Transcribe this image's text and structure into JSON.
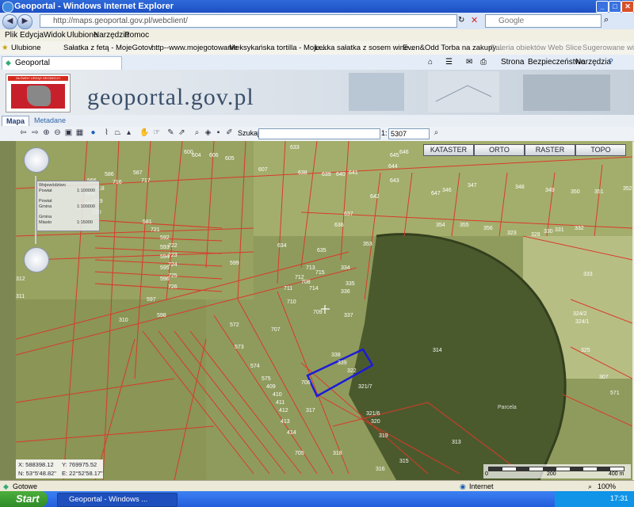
{
  "window": {
    "title": "Geoportal - Windows Internet Explorer"
  },
  "address": {
    "url": "http://maps.geoportal.gov.pl/webclient/",
    "search_placeholder": "Google"
  },
  "menu": [
    "Plik",
    "Edycja",
    "Widok",
    "Ulubione",
    "Narzędzia",
    "Pomoc"
  ],
  "favorites": {
    "label": "Ulubione",
    "items": [
      "Sałatka z fetą - MojeGotov...",
      "http--www.mojegotowanie",
      "Meksykańska tortilla - Moje...",
      "Lekka sałatka z sosem wine...",
      "Even&Odd Torba na zakupy...",
      "Galeria obiektów Web Slice",
      "Sugerowane witryny"
    ]
  },
  "tab": {
    "label": "Geoportal",
    "tools": [
      "Strona",
      "Bezpieczeństwo",
      "Narzędzia"
    ]
  },
  "banner": {
    "site_name": "geoportal.gov.pl",
    "logo_text": "GŁÓWNY URZĄD GEODEZJI I KARTOGRAFII"
  },
  "content_tabs": [
    "Mapa",
    "Metadane"
  ],
  "toolbar": {
    "search_label": "Szukaj:",
    "scale_prefix": "1:",
    "scale_value": "5307"
  },
  "layers": [
    "KATASTER",
    "ORTO",
    "RASTER",
    "TOPO"
  ],
  "legend": [
    "Województwo",
    "Powiat",
    "1:100000",
    "Powiat",
    "Gmina",
    "1:100000",
    "Gmina",
    "Miasto",
    "1:15000"
  ],
  "coords": {
    "x": "X: 588398.12",
    "y": "Y: 769975.52",
    "n": "N: 53°5'48.82\"",
    "e": "E: 22°52'58.17\""
  },
  "scalebar": {
    "label": "0",
    "mid": "200",
    "end": "400 m"
  },
  "parcels": [
    "586",
    "587",
    "566",
    "569",
    "563",
    "581",
    "592",
    "593",
    "594",
    "595",
    "596",
    "597",
    "598",
    "599",
    "605",
    "606",
    "604",
    "600",
    "607",
    "633",
    "634",
    "635",
    "636",
    "637",
    "638",
    "639",
    "640",
    "641",
    "642",
    "643",
    "644",
    "645",
    "646",
    "647",
    "346",
    "347",
    "348",
    "349",
    "350",
    "351",
    "352",
    "353",
    "354",
    "355",
    "356",
    "323",
    "328",
    "330",
    "331",
    "332",
    "333",
    "334",
    "335",
    "336",
    "337",
    "338",
    "339",
    "322",
    "321/7",
    "321/6",
    "320",
    "319",
    "318",
    "317",
    "316",
    "315",
    "314",
    "313",
    "312",
    "311",
    "310",
    "324/2",
    "324/1",
    "325",
    "307",
    "571",
    "572",
    "573",
    "574",
    "575",
    "409",
    "410",
    "411",
    "412",
    "413",
    "414",
    "705",
    "706",
    "707",
    "708",
    "709",
    "710",
    "711",
    "712",
    "713",
    "714",
    "715",
    "716",
    "717",
    "718",
    "719",
    "720",
    "721",
    "722",
    "723",
    "724",
    "725",
    "726"
  ],
  "forest_label": "Parcela",
  "status": {
    "left": "Gotowe",
    "zone": "Internet",
    "zoom": "100%"
  },
  "taskbar": {
    "start": "Start",
    "item": "Geoportal - Windows ...",
    "clock": "17:31"
  }
}
